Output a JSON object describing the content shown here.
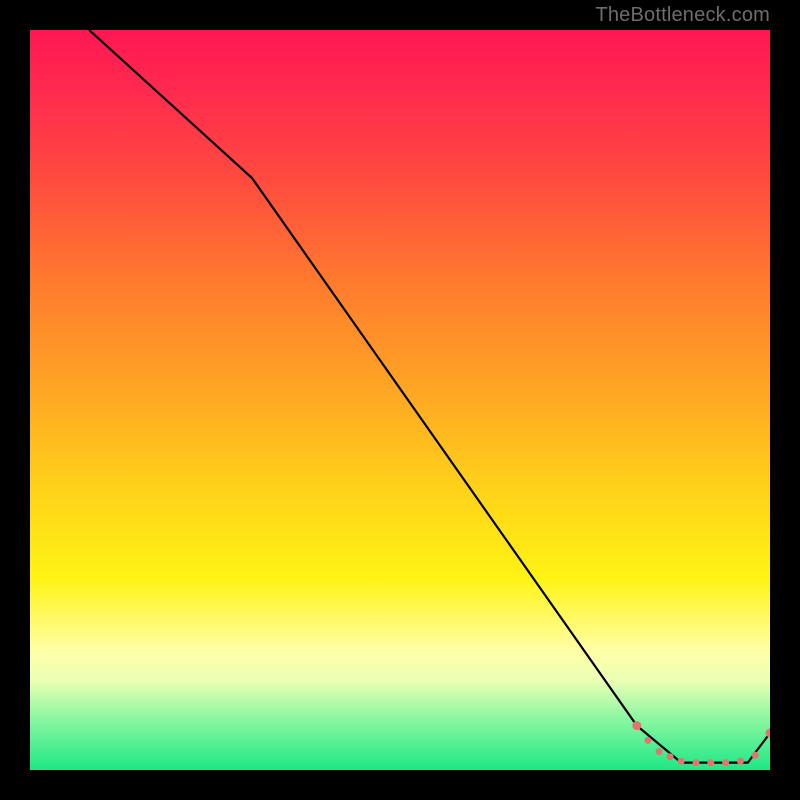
{
  "watermark": "TheBottleneck.com",
  "colors": {
    "line": "#000000",
    "marker_fill": "#e2766f",
    "marker_stroke": "#e2766f"
  },
  "chart_data": {
    "type": "line",
    "title": "",
    "xlabel": "",
    "ylabel": "",
    "xlim": [
      0,
      100
    ],
    "ylim": [
      0,
      100
    ],
    "series": [
      {
        "name": "curve",
        "x": [
          8,
          30,
          82,
          88,
          97,
          100
        ],
        "y": [
          100,
          80,
          6,
          1,
          1,
          5
        ]
      }
    ],
    "markers": {
      "name": "highlight-band",
      "points": [
        {
          "x": 82,
          "y": 6,
          "r": 4
        },
        {
          "x": 83.5,
          "y": 4,
          "r": 3
        },
        {
          "x": 85,
          "y": 2.5,
          "r": 3
        },
        {
          "x": 86.5,
          "y": 1.8,
          "r": 3
        },
        {
          "x": 88,
          "y": 1.2,
          "r": 3
        },
        {
          "x": 90,
          "y": 1,
          "r": 3
        },
        {
          "x": 92,
          "y": 1,
          "r": 3
        },
        {
          "x": 94,
          "y": 1,
          "r": 3
        },
        {
          "x": 96,
          "y": 1.2,
          "r": 3
        },
        {
          "x": 98,
          "y": 2,
          "r": 3
        },
        {
          "x": 100,
          "y": 5,
          "r": 4
        }
      ]
    }
  }
}
